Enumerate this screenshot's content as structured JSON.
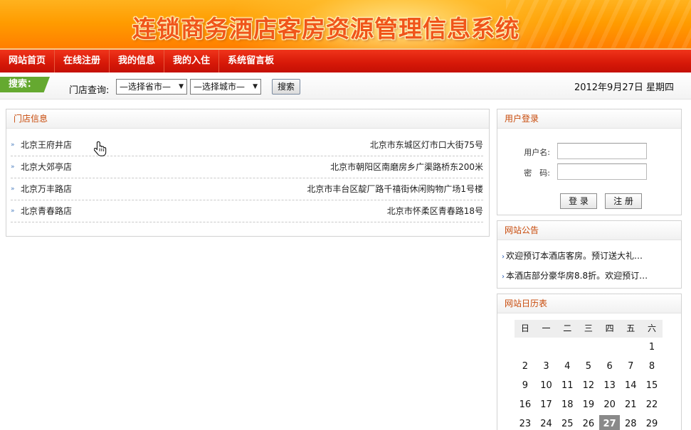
{
  "banner": {
    "title": "连锁商务酒店客房资源管理信息系统"
  },
  "nav": {
    "items": [
      "网站首页",
      "在线注册",
      "我的信息",
      "我的入住",
      "系统留言板"
    ]
  },
  "search": {
    "tag": "搜索：",
    "store_query_label": "门店查询:",
    "province_select": "—选择省市—",
    "city_select": "—选择城市—",
    "button": "搜索",
    "date": "2012年9月27日  星期四"
  },
  "stores": {
    "title": "门店信息",
    "rows": [
      {
        "name": "北京王府井店",
        "address": "北京市东城区灯市口大街75号"
      },
      {
        "name": "北京大郊亭店",
        "address": "北京市朝阳区南磨房乡广渠路桥东200米"
      },
      {
        "name": "北京万丰路店",
        "address": "北京市丰台区靛厂路千禧街休闲购物广场1号楼"
      },
      {
        "name": "北京青春路店",
        "address": "北京市怀柔区青春路18号"
      }
    ]
  },
  "login": {
    "title": "用户登录",
    "username_label": "用户名:",
    "password_label": "密　码:",
    "login_button": "登 录",
    "register_button": "注 册"
  },
  "notices": {
    "title": "网站公告",
    "items": [
      "欢迎预订本酒店客房。预订送大礼…",
      "本酒店部分豪华房8.8折。欢迎预订…"
    ]
  },
  "calendar": {
    "title": "网站日历表",
    "weekdays": [
      "日",
      "一",
      "二",
      "三",
      "四",
      "五",
      "六"
    ],
    "weeks": [
      [
        "",
        "",
        "",
        "",
        "",
        "",
        "1"
      ],
      [
        "2",
        "3",
        "4",
        "5",
        "6",
        "7",
        "8"
      ],
      [
        "9",
        "10",
        "11",
        "12",
        "13",
        "14",
        "15"
      ],
      [
        "16",
        "17",
        "18",
        "19",
        "20",
        "21",
        "22"
      ],
      [
        "23",
        "24",
        "25",
        "26",
        "27",
        "28",
        "29"
      ]
    ],
    "today": "27"
  },
  "colors": {
    "nav_red": "#d61808",
    "search_tag_green": "#65a930",
    "panel_title": "#c84a0a",
    "banner_orange": "#ff9c00"
  }
}
